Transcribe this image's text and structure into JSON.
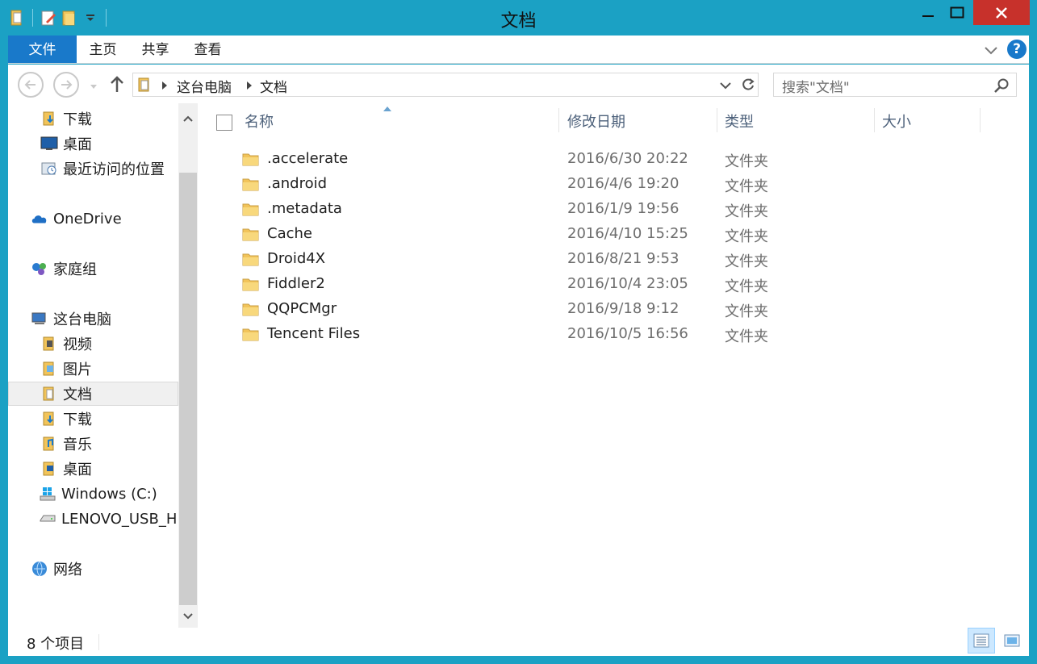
{
  "window": {
    "title": "文档"
  },
  "ribbon": {
    "tabs": [
      {
        "label": "文件"
      },
      {
        "label": "主页"
      },
      {
        "label": "共享"
      },
      {
        "label": "查看"
      }
    ],
    "help_label": "?"
  },
  "address": {
    "crumbs": [
      "这台电脑",
      "文档"
    ],
    "search_placeholder": "搜索\"文档\""
  },
  "nav_pane": {
    "items": [
      {
        "label": "下载",
        "icon": "downloads-folder-icon"
      },
      {
        "label": "桌面",
        "icon": "desktop-icon"
      },
      {
        "label": "最近访问的位置",
        "icon": "recent-places-icon"
      },
      {
        "label": "OneDrive",
        "icon": "onedrive-cloud-icon"
      },
      {
        "label": "家庭组",
        "icon": "homegroup-icon"
      },
      {
        "label": "这台电脑",
        "icon": "computer-icon"
      },
      {
        "label": "视频",
        "icon": "videos-folder-icon"
      },
      {
        "label": "图片",
        "icon": "pictures-folder-icon"
      },
      {
        "label": "文档",
        "icon": "documents-folder-icon",
        "selected": true
      },
      {
        "label": "下载",
        "icon": "downloads-folder-icon"
      },
      {
        "label": "音乐",
        "icon": "music-folder-icon"
      },
      {
        "label": "桌面",
        "icon": "desktop-folder-icon"
      },
      {
        "label": "Windows (C:)",
        "icon": "windows-drive-icon"
      },
      {
        "label": "LENOVO_USB_H",
        "icon": "drive-icon"
      },
      {
        "label": "网络",
        "icon": "network-icon"
      }
    ]
  },
  "file_list": {
    "columns": [
      "名称",
      "修改日期",
      "类型",
      "大小"
    ],
    "rows": [
      {
        "name": ".accelerate",
        "date": "2016/6/30 20:22",
        "type": "文件夹",
        "size": ""
      },
      {
        "name": ".android",
        "date": "2016/4/6 19:20",
        "type": "文件夹",
        "size": ""
      },
      {
        "name": ".metadata",
        "date": "2016/1/9 19:56",
        "type": "文件夹",
        "size": ""
      },
      {
        "name": "Cache",
        "date": "2016/4/10 15:25",
        "type": "文件夹",
        "size": ""
      },
      {
        "name": "Droid4X",
        "date": "2016/8/21 9:53",
        "type": "文件夹",
        "size": ""
      },
      {
        "name": "Fiddler2",
        "date": "2016/10/4 23:05",
        "type": "文件夹",
        "size": ""
      },
      {
        "name": "QQPCMgr",
        "date": "2016/9/18 9:12",
        "type": "文件夹",
        "size": ""
      },
      {
        "name": "Tencent Files",
        "date": "2016/10/5 16:56",
        "type": "文件夹",
        "size": ""
      }
    ]
  },
  "status": {
    "item_count": "8 个项目"
  },
  "colors": {
    "titlebar": "#1ba1c4",
    "file_tab": "#1979ca",
    "close_button": "#c7312b",
    "folder": "#f2c45a",
    "selected_view": "#cce8ff"
  }
}
